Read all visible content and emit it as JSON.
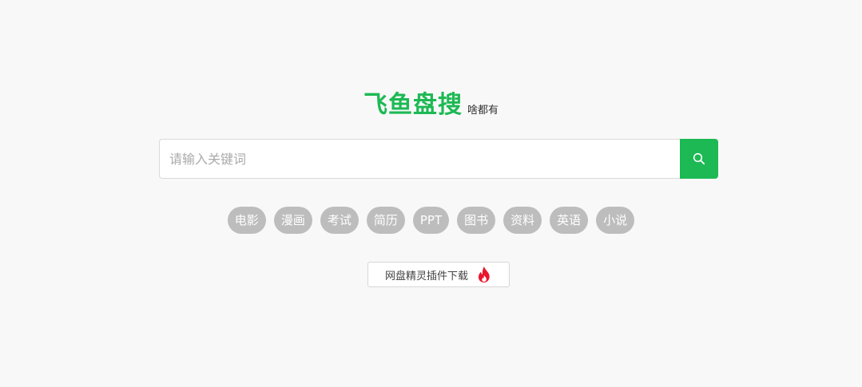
{
  "logo": {
    "title": "飞鱼盘搜",
    "tagline": "啥都有"
  },
  "search": {
    "placeholder": "请输入关键词",
    "value": "",
    "button_icon": "search-icon"
  },
  "tags": [
    "电影",
    "漫画",
    "考试",
    "简历",
    "PPT",
    "图书",
    "资料",
    "英语",
    "小说"
  ],
  "plugin": {
    "label": "网盘精灵插件下载",
    "icon": "fire-icon"
  },
  "colors": {
    "brand": "#1db954",
    "tag_bg": "#bdbdbd",
    "background": "#f8f8f8",
    "fire": "#e8172c"
  }
}
